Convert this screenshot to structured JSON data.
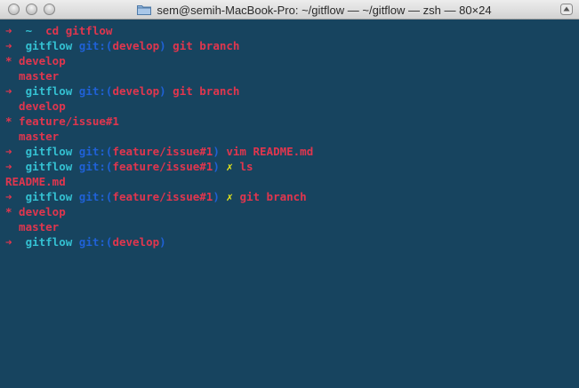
{
  "window": {
    "title": "sem@semih-MacBook-Pro: ~/gitflow — ~/gitflow — zsh — 80×24"
  },
  "colors": {
    "background": "#17445f",
    "arrow": "#e0364e",
    "directory": "#34c1d2",
    "git_label": "#1f61d6",
    "branch": "#e0364e",
    "command": "#e0364e",
    "dirty_mark": "#e7e61a",
    "output": "#e0364e"
  },
  "terminal": {
    "lines": [
      [
        {
          "text": "➜  ",
          "color": "red"
        },
        {
          "text": "~  ",
          "color": "cyan"
        },
        {
          "text": "cd gitflow",
          "color": "red"
        }
      ],
      [
        {
          "text": "➜  ",
          "color": "red"
        },
        {
          "text": "gitflow ",
          "color": "cyan"
        },
        {
          "text": "git:(",
          "color": "blue"
        },
        {
          "text": "develop",
          "color": "red"
        },
        {
          "text": ")",
          "color": "blue"
        },
        {
          "text": " git branch",
          "color": "red"
        }
      ],
      [
        {
          "text": "* develop",
          "color": "red"
        }
      ],
      [
        {
          "text": "  master",
          "color": "red"
        }
      ],
      [
        {
          "text": "➜  ",
          "color": "red"
        },
        {
          "text": "gitflow ",
          "color": "cyan"
        },
        {
          "text": "git:(",
          "color": "blue"
        },
        {
          "text": "develop",
          "color": "red"
        },
        {
          "text": ")",
          "color": "blue"
        },
        {
          "text": " git branch",
          "color": "red"
        }
      ],
      [
        {
          "text": "  develop",
          "color": "red"
        }
      ],
      [
        {
          "text": "* feature/issue#1",
          "color": "red"
        }
      ],
      [
        {
          "text": "  master",
          "color": "red"
        }
      ],
      [
        {
          "text": "➜  ",
          "color": "red"
        },
        {
          "text": "gitflow ",
          "color": "cyan"
        },
        {
          "text": "git:(",
          "color": "blue"
        },
        {
          "text": "feature/issue#1",
          "color": "red"
        },
        {
          "text": ")",
          "color": "blue"
        },
        {
          "text": " vim README.md",
          "color": "red"
        }
      ],
      [
        {
          "text": "➜  ",
          "color": "red"
        },
        {
          "text": "gitflow ",
          "color": "cyan"
        },
        {
          "text": "git:(",
          "color": "blue"
        },
        {
          "text": "feature/issue#1",
          "color": "red"
        },
        {
          "text": ")",
          "color": "blue"
        },
        {
          "text": " ✗",
          "color": "yellow"
        },
        {
          "text": " ls",
          "color": "red"
        }
      ],
      [
        {
          "text": "README.md",
          "color": "red"
        }
      ],
      [
        {
          "text": "➜  ",
          "color": "red"
        },
        {
          "text": "gitflow ",
          "color": "cyan"
        },
        {
          "text": "git:(",
          "color": "blue"
        },
        {
          "text": "feature/issue#1",
          "color": "red"
        },
        {
          "text": ")",
          "color": "blue"
        },
        {
          "text": " ✗",
          "color": "yellow"
        },
        {
          "text": " git branch",
          "color": "red"
        }
      ],
      [
        {
          "text": "* develop",
          "color": "red"
        }
      ],
      [
        {
          "text": "  master",
          "color": "red"
        }
      ],
      [
        {
          "text": "➜  ",
          "color": "red"
        },
        {
          "text": "gitflow ",
          "color": "cyan"
        },
        {
          "text": "git:(",
          "color": "blue"
        },
        {
          "text": "develop",
          "color": "red"
        },
        {
          "text": ")",
          "color": "blue"
        }
      ]
    ]
  }
}
